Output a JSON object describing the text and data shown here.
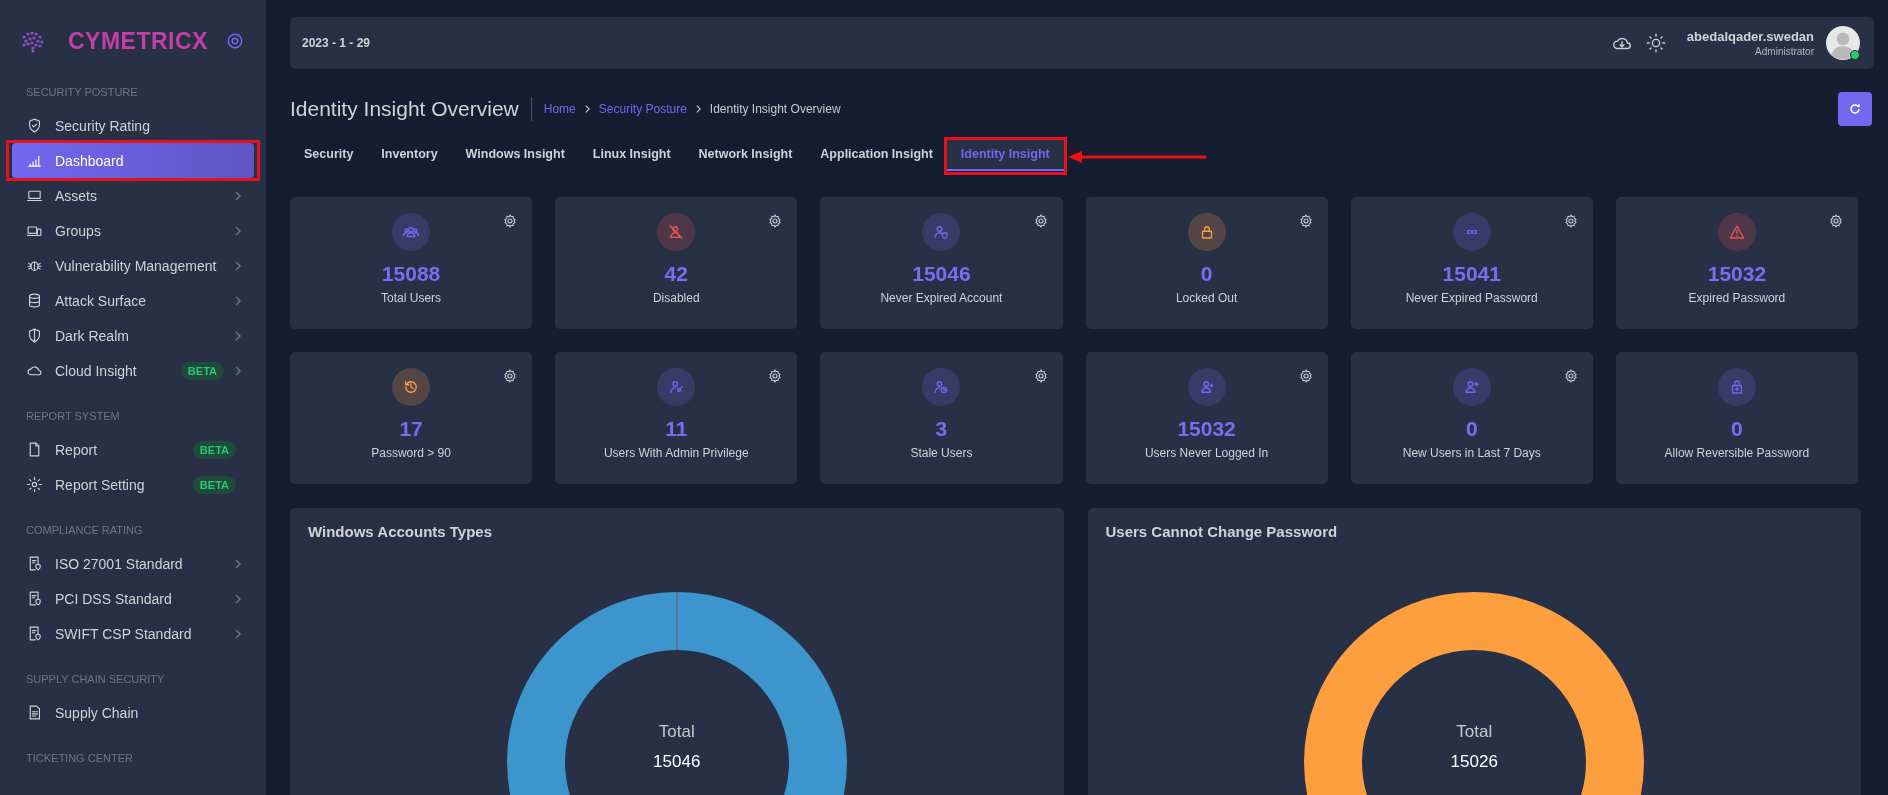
{
  "sidebar": {
    "brand": "CYMETRICX",
    "sections": [
      {
        "title": "SECURITY POSTURE",
        "items": [
          {
            "label": "Security Rating",
            "selected": false,
            "submenu": false
          },
          {
            "label": "Dashboard",
            "selected": true,
            "submenu": false,
            "annotated": true
          },
          {
            "label": "Assets",
            "selected": false,
            "submenu": true
          },
          {
            "label": "Groups",
            "selected": false,
            "submenu": true
          },
          {
            "label": "Vulnerability Management",
            "selected": false,
            "submenu": true
          },
          {
            "label": "Attack Surface",
            "selected": false,
            "submenu": true
          },
          {
            "label": "Dark Realm",
            "selected": false,
            "submenu": true
          },
          {
            "label": "Cloud Insight",
            "selected": false,
            "submenu": true,
            "badge": "BETA"
          }
        ]
      },
      {
        "title": "REPORT SYSTEM",
        "items": [
          {
            "label": "Report",
            "selected": false,
            "submenu": false,
            "badge": "BETA"
          },
          {
            "label": "Report Setting",
            "selected": false,
            "submenu": false,
            "badge": "BETA"
          }
        ]
      },
      {
        "title": "COMPLIANCE RATING",
        "items": [
          {
            "label": "ISO 27001 Standard",
            "selected": false,
            "submenu": true
          },
          {
            "label": "PCI DSS Standard",
            "selected": false,
            "submenu": true
          },
          {
            "label": "SWIFT CSP Standard",
            "selected": false,
            "submenu": true
          }
        ]
      },
      {
        "title": "SUPPLY CHAIN SECURITY",
        "items": [
          {
            "label": "Supply Chain",
            "selected": false,
            "submenu": false
          }
        ]
      },
      {
        "title": "TICKETING CENTER"
      }
    ]
  },
  "header": {
    "date": "2023 - 1 - 29",
    "user": {
      "name": "abedalqader.swedan",
      "role": "Administrator",
      "online": true
    }
  },
  "page": {
    "title": "Identity Insight Overview",
    "breadcrumb": [
      {
        "label": "Home",
        "link": true
      },
      {
        "label": "Security Posture",
        "link": true
      },
      {
        "label": "Identity Insight Overview",
        "link": false
      }
    ]
  },
  "tabs": [
    {
      "label": "Security",
      "selected": false
    },
    {
      "label": "Inventory",
      "selected": false
    },
    {
      "label": "Windows Insight",
      "selected": false
    },
    {
      "label": "Linux Insight",
      "selected": false
    },
    {
      "label": "Network Insight",
      "selected": false
    },
    {
      "label": "Application Insight",
      "selected": false
    },
    {
      "label": "Identity Insight",
      "selected": true,
      "annotated": true
    }
  ],
  "stats": [
    {
      "value": "15088",
      "label": "Total Users",
      "color": "#7367f0",
      "settings": true
    },
    {
      "value": "42",
      "label": "Disabled",
      "color": "#ea5455",
      "settings": true
    },
    {
      "value": "15046",
      "label": "Never Expired Account",
      "color": "#7367f0",
      "settings": true
    },
    {
      "value": "0",
      "label": "Locked Out",
      "color": "#ff9f43",
      "settings": true
    },
    {
      "value": "15041",
      "label": "Never Expired Password",
      "color": "#7367f0",
      "settings": true
    },
    {
      "value": "15032",
      "label": "Expired Password",
      "color": "#ea5455",
      "settings": true
    },
    {
      "value": "17",
      "label": "Password > 90",
      "color": "#ff9f43",
      "settings": true
    },
    {
      "value": "11",
      "label": "Users With Admin Privilege",
      "color": "#7367f0",
      "settings": true
    },
    {
      "value": "3",
      "label": "Stale Users",
      "color": "#7367f0",
      "settings": true
    },
    {
      "value": "15032",
      "label": "Users Never Logged In",
      "color": "#7367f0",
      "settings": true
    },
    {
      "value": "0",
      "label": "New Users in Last 7 Days",
      "color": "#7367f0",
      "settings": true
    },
    {
      "value": "0",
      "label": "Allow Reversible Password",
      "color": "#7367f0",
      "settings": false
    }
  ],
  "charts": [
    {
      "title": "Windows Accounts Types",
      "center_label": "Total",
      "center_value": "15046",
      "color": "#3d95cd"
    },
    {
      "title": "Users Cannot Change Password",
      "center_label": "Total",
      "center_value": "15026",
      "color": "#fd9f3e"
    }
  ]
}
